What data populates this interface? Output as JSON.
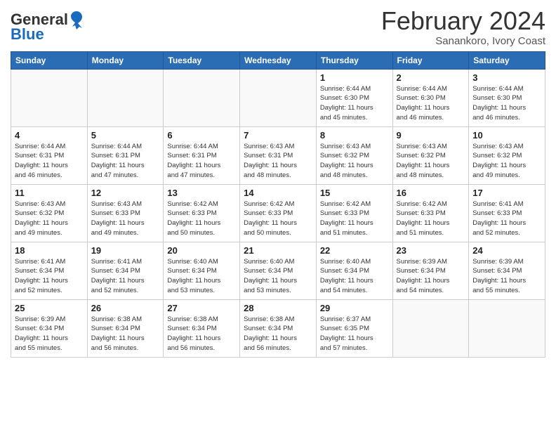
{
  "logo": {
    "general": "General",
    "blue": "Blue"
  },
  "title": "February 2024",
  "subtitle": "Sanankoro, Ivory Coast",
  "days_of_week": [
    "Sunday",
    "Monday",
    "Tuesday",
    "Wednesday",
    "Thursday",
    "Friday",
    "Saturday"
  ],
  "weeks": [
    [
      {
        "day": "",
        "info": ""
      },
      {
        "day": "",
        "info": ""
      },
      {
        "day": "",
        "info": ""
      },
      {
        "day": "",
        "info": ""
      },
      {
        "day": "1",
        "info": "Sunrise: 6:44 AM\nSunset: 6:30 PM\nDaylight: 11 hours\nand 45 minutes."
      },
      {
        "day": "2",
        "info": "Sunrise: 6:44 AM\nSunset: 6:30 PM\nDaylight: 11 hours\nand 46 minutes."
      },
      {
        "day": "3",
        "info": "Sunrise: 6:44 AM\nSunset: 6:30 PM\nDaylight: 11 hours\nand 46 minutes."
      }
    ],
    [
      {
        "day": "4",
        "info": "Sunrise: 6:44 AM\nSunset: 6:31 PM\nDaylight: 11 hours\nand 46 minutes."
      },
      {
        "day": "5",
        "info": "Sunrise: 6:44 AM\nSunset: 6:31 PM\nDaylight: 11 hours\nand 47 minutes."
      },
      {
        "day": "6",
        "info": "Sunrise: 6:44 AM\nSunset: 6:31 PM\nDaylight: 11 hours\nand 47 minutes."
      },
      {
        "day": "7",
        "info": "Sunrise: 6:43 AM\nSunset: 6:31 PM\nDaylight: 11 hours\nand 48 minutes."
      },
      {
        "day": "8",
        "info": "Sunrise: 6:43 AM\nSunset: 6:32 PM\nDaylight: 11 hours\nand 48 minutes."
      },
      {
        "day": "9",
        "info": "Sunrise: 6:43 AM\nSunset: 6:32 PM\nDaylight: 11 hours\nand 48 minutes."
      },
      {
        "day": "10",
        "info": "Sunrise: 6:43 AM\nSunset: 6:32 PM\nDaylight: 11 hours\nand 49 minutes."
      }
    ],
    [
      {
        "day": "11",
        "info": "Sunrise: 6:43 AM\nSunset: 6:32 PM\nDaylight: 11 hours\nand 49 minutes."
      },
      {
        "day": "12",
        "info": "Sunrise: 6:43 AM\nSunset: 6:33 PM\nDaylight: 11 hours\nand 49 minutes."
      },
      {
        "day": "13",
        "info": "Sunrise: 6:42 AM\nSunset: 6:33 PM\nDaylight: 11 hours\nand 50 minutes."
      },
      {
        "day": "14",
        "info": "Sunrise: 6:42 AM\nSunset: 6:33 PM\nDaylight: 11 hours\nand 50 minutes."
      },
      {
        "day": "15",
        "info": "Sunrise: 6:42 AM\nSunset: 6:33 PM\nDaylight: 11 hours\nand 51 minutes."
      },
      {
        "day": "16",
        "info": "Sunrise: 6:42 AM\nSunset: 6:33 PM\nDaylight: 11 hours\nand 51 minutes."
      },
      {
        "day": "17",
        "info": "Sunrise: 6:41 AM\nSunset: 6:33 PM\nDaylight: 11 hours\nand 52 minutes."
      }
    ],
    [
      {
        "day": "18",
        "info": "Sunrise: 6:41 AM\nSunset: 6:34 PM\nDaylight: 11 hours\nand 52 minutes."
      },
      {
        "day": "19",
        "info": "Sunrise: 6:41 AM\nSunset: 6:34 PM\nDaylight: 11 hours\nand 52 minutes."
      },
      {
        "day": "20",
        "info": "Sunrise: 6:40 AM\nSunset: 6:34 PM\nDaylight: 11 hours\nand 53 minutes."
      },
      {
        "day": "21",
        "info": "Sunrise: 6:40 AM\nSunset: 6:34 PM\nDaylight: 11 hours\nand 53 minutes."
      },
      {
        "day": "22",
        "info": "Sunrise: 6:40 AM\nSunset: 6:34 PM\nDaylight: 11 hours\nand 54 minutes."
      },
      {
        "day": "23",
        "info": "Sunrise: 6:39 AM\nSunset: 6:34 PM\nDaylight: 11 hours\nand 54 minutes."
      },
      {
        "day": "24",
        "info": "Sunrise: 6:39 AM\nSunset: 6:34 PM\nDaylight: 11 hours\nand 55 minutes."
      }
    ],
    [
      {
        "day": "25",
        "info": "Sunrise: 6:39 AM\nSunset: 6:34 PM\nDaylight: 11 hours\nand 55 minutes."
      },
      {
        "day": "26",
        "info": "Sunrise: 6:38 AM\nSunset: 6:34 PM\nDaylight: 11 hours\nand 56 minutes."
      },
      {
        "day": "27",
        "info": "Sunrise: 6:38 AM\nSunset: 6:34 PM\nDaylight: 11 hours\nand 56 minutes."
      },
      {
        "day": "28",
        "info": "Sunrise: 6:38 AM\nSunset: 6:34 PM\nDaylight: 11 hours\nand 56 minutes."
      },
      {
        "day": "29",
        "info": "Sunrise: 6:37 AM\nSunset: 6:35 PM\nDaylight: 11 hours\nand 57 minutes."
      },
      {
        "day": "",
        "info": ""
      },
      {
        "day": "",
        "info": ""
      }
    ]
  ]
}
